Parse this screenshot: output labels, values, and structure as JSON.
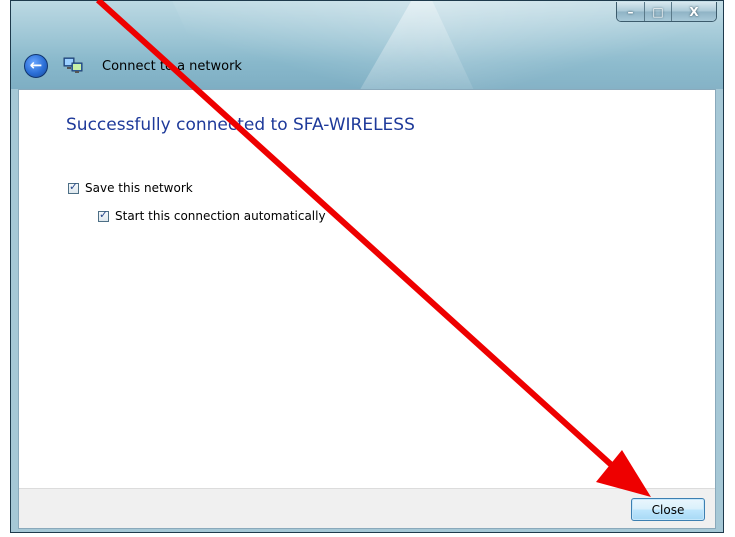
{
  "window": {
    "title": "Connect to a network",
    "caption": {
      "minimize": "–",
      "maximize": "□",
      "close": "X"
    }
  },
  "main": {
    "heading": "Successfully connected to SFA-WIRELESS",
    "options": [
      {
        "label": "Save this network",
        "checked": true
      },
      {
        "label": "Start this connection automatically",
        "checked": true
      }
    ]
  },
  "footer": {
    "close_label": "Close"
  },
  "icons": {
    "back": "back-arrow-icon",
    "network": "network-icon"
  },
  "colors": {
    "heading": "#1e3a9a",
    "annotation_arrow": "#ee0000"
  }
}
